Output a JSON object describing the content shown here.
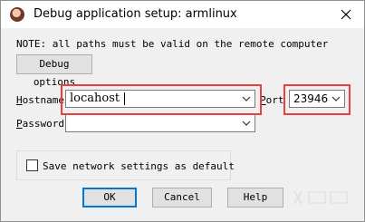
{
  "window": {
    "title": "Debug application setup: armlinux"
  },
  "note": "NOTE: all paths must be valid on the remote computer",
  "buttons": {
    "debug_options": "Debug options",
    "ok": "OK",
    "cancel": "Cancel",
    "help": "Help"
  },
  "hostname": {
    "label_first": "H",
    "label_rest": "ostname",
    "value": "locahost"
  },
  "port": {
    "label_first": "P",
    "label_rest": "ort",
    "value": "23946"
  },
  "password": {
    "label_first": "P",
    "label_rest": "assword",
    "value": ""
  },
  "save_settings": {
    "label": "Save network settings as default",
    "checked": false
  },
  "colors": {
    "highlight": "#e8403f",
    "default_button_border": "#0078d7"
  }
}
